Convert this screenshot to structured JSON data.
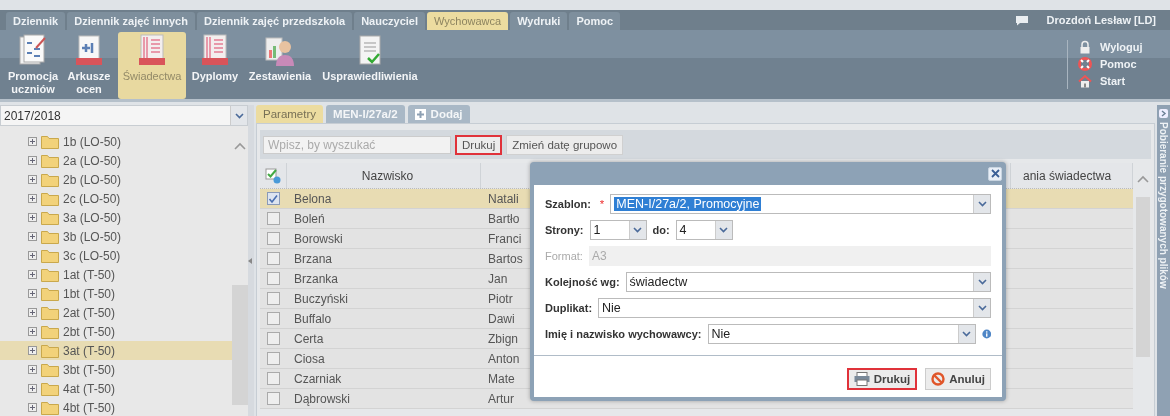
{
  "menu_tabs": [
    {
      "label": "Dziennik",
      "selected": false
    },
    {
      "label": "Dziennik zajęć innych",
      "selected": false
    },
    {
      "label": "Dziennik zajęć przedszkola",
      "selected": false
    },
    {
      "label": "Nauczyciel",
      "selected": false
    },
    {
      "label": "Wychowawca",
      "selected": true
    },
    {
      "label": "Wydruki",
      "selected": false
    },
    {
      "label": "Pomoc",
      "selected": false
    }
  ],
  "user": {
    "name": "Drozdoń Lesław [LD]"
  },
  "toolbar": [
    {
      "label": "Promocja uczniów",
      "kind": "grades",
      "selected": false
    },
    {
      "label": "Arkusze ocen",
      "kind": "pdf-grade",
      "selected": false
    },
    {
      "label": "Świadectwa",
      "kind": "pdf-doc",
      "selected": true
    },
    {
      "label": "Dyplomy",
      "kind": "pdf-doc",
      "selected": false
    },
    {
      "label": "Zestawienia",
      "kind": "person",
      "selected": false
    },
    {
      "label": "Usprawiedliwienia",
      "kind": "check-doc",
      "selected": false
    }
  ],
  "quick_links": [
    {
      "label": "Wyloguj",
      "kind": "lock"
    },
    {
      "label": "Pomoc",
      "kind": "help"
    },
    {
      "label": "Start",
      "kind": "home"
    }
  ],
  "sidebar": {
    "year": "2017/2018",
    "items": [
      {
        "label": "1b (LO-50)",
        "selected": false
      },
      {
        "label": "2a (LO-50)",
        "selected": false
      },
      {
        "label": "2b (LO-50)",
        "selected": false
      },
      {
        "label": "2c (LO-50)",
        "selected": false
      },
      {
        "label": "3a (LO-50)",
        "selected": false
      },
      {
        "label": "3b (LO-50)",
        "selected": false
      },
      {
        "label": "3c (LO-50)",
        "selected": false
      },
      {
        "label": "1at (T-50)",
        "selected": false
      },
      {
        "label": "1bt (T-50)",
        "selected": false
      },
      {
        "label": "2at (T-50)",
        "selected": false
      },
      {
        "label": "2bt (T-50)",
        "selected": false
      },
      {
        "label": "3at (T-50)",
        "selected": true
      },
      {
        "label": "3bt (T-50)",
        "selected": false
      },
      {
        "label": "4at (T-50)",
        "selected": false
      },
      {
        "label": "4bt (T-50)",
        "selected": false
      }
    ]
  },
  "content_tabs": [
    {
      "label": "Parametry",
      "kind": "plain",
      "selected": true
    },
    {
      "label": "MEN-I/27a/2",
      "kind": "plain",
      "selected": false
    },
    {
      "label": "Dodaj",
      "kind": "add",
      "selected": false
    }
  ],
  "search": {
    "placeholder": "Wpisz, by wyszukać"
  },
  "buttons": [
    {
      "label": "Drukuj",
      "highlighted": true
    },
    {
      "label": "Zmień datę grupowo",
      "highlighted": false
    }
  ],
  "table": {
    "columns": [
      "Nazwisko",
      "ania świadectwa"
    ],
    "rows": [
      {
        "surname": "Belona",
        "first_name": "Natali",
        "checked": true,
        "selected": true
      },
      {
        "surname": "Boleń",
        "first_name": "Bartło",
        "checked": false,
        "selected": false
      },
      {
        "surname": "Borowski",
        "first_name": "Franci",
        "checked": false,
        "selected": false
      },
      {
        "surname": "Brzana",
        "first_name": "Bartos",
        "checked": false,
        "selected": false
      },
      {
        "surname": "Brzanka",
        "first_name": "Jan",
        "checked": false,
        "selected": false
      },
      {
        "surname": "Buczyński",
        "first_name": "Piotr",
        "checked": false,
        "selected": false
      },
      {
        "surname": "Buffalo",
        "first_name": "Dawi",
        "checked": false,
        "selected": false
      },
      {
        "surname": "Certa",
        "first_name": "Zbign",
        "checked": false,
        "selected": false
      },
      {
        "surname": "Ciosa",
        "first_name": "Anton",
        "checked": false,
        "selected": false
      },
      {
        "surname": "Czarniak",
        "first_name": "Mate",
        "checked": false,
        "selected": false
      },
      {
        "surname": "Dąbrowski",
        "first_name": "Artur",
        "checked": false,
        "selected": false
      }
    ]
  },
  "dialog": {
    "fields": [
      {
        "label": "Szablon:",
        "kind": "select",
        "required_mark": "*",
        "value": "MEN-I/27a/2, Promocyjne",
        "text_selected": true
      },
      {
        "label": "Strony:",
        "kind": "range",
        "from": "1",
        "to_label": "do:",
        "to": "4"
      },
      {
        "label": "Format:",
        "kind": "readonly",
        "value": "A3"
      },
      {
        "label": "Kolejność wg:",
        "kind": "select",
        "value": "świadectw"
      },
      {
        "label": "Duplikat:",
        "kind": "select",
        "value": "Nie"
      },
      {
        "label": "Imię i nazwisko wychowawcy:",
        "kind": "select",
        "value": "Nie",
        "info": true
      }
    ],
    "buttons": [
      {
        "label": "Drukuj",
        "kind": "print",
        "highlighted": true
      },
      {
        "label": "Anuluj",
        "kind": "cancel",
        "highlighted": false
      }
    ]
  },
  "side_panel": {
    "title": "Pobieranie przygotowanych plików"
  }
}
